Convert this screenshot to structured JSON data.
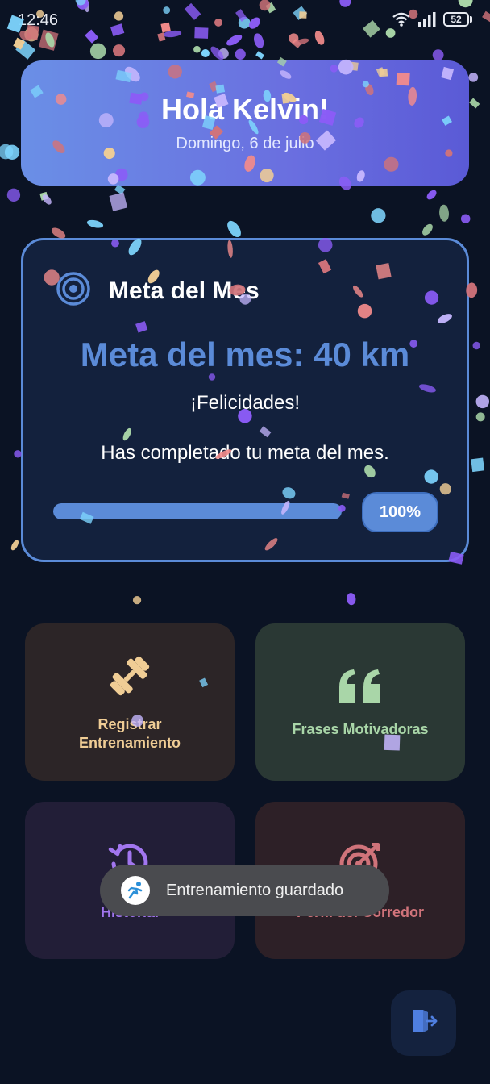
{
  "status_bar": {
    "time": "12:46",
    "battery": "52",
    "icons": [
      "wifi-icon",
      "signal-icon",
      "battery-icon"
    ]
  },
  "greeting": {
    "title": "Hola Kelvin!",
    "date": "Domingo, 6 de julio"
  },
  "goal": {
    "header_title": "Meta del Mes",
    "header_icon": "target-icon",
    "main_text": "Meta del mes: 40 km",
    "congrats": "¡Felicidades!",
    "message": "Has completado tu meta del mes.",
    "progress_fraction": 1.0,
    "progress_label": "100%"
  },
  "tiles": [
    {
      "label": "Registrar Entrenamiento",
      "icon": "dumbbell-icon",
      "color": "#f0cd95"
    },
    {
      "label": "Frases Motivadoras",
      "icon": "quote-icon",
      "color": "#a9d6a8"
    },
    {
      "label": "Historial",
      "icon": "history-icon",
      "color": "#a276ef"
    },
    {
      "label": "Perfil del Corredor",
      "icon": "target-arrow-icon",
      "color": "#d0737a"
    }
  ],
  "toast": {
    "text": "Entrenamiento guardado",
    "icon": "runner-icon"
  },
  "logout": {
    "icon": "logout-icon"
  },
  "colors": {
    "background": "#0b1324",
    "accent": "#5b8bd8",
    "card": "#13213d"
  }
}
